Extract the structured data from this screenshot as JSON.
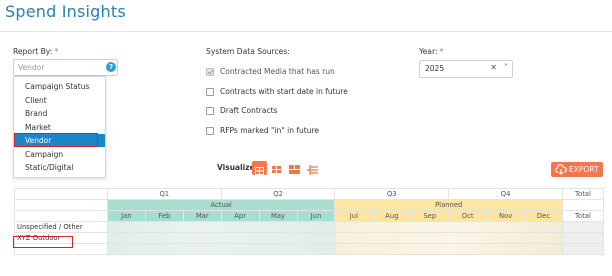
{
  "page": {
    "title": "Spend Insights"
  },
  "report_by": {
    "label": "Report By:",
    "required_mark": "*",
    "placeholder": "Vendor",
    "options": [
      "Campaign Status",
      "Client",
      "Brand",
      "Market",
      "Vendor",
      "Campaign",
      "Static/Digital"
    ],
    "selected": "Vendor"
  },
  "data_sources": {
    "label": "System Data Sources:",
    "items": [
      {
        "label": "Contracted Media that has run",
        "checked": true,
        "disabled": true
      },
      {
        "label": "Contracts with start date in future",
        "checked": false
      },
      {
        "label": "Draft Contracts",
        "checked": false
      },
      {
        "label": "RFPs marked \"in\" in future",
        "checked": false
      }
    ]
  },
  "year": {
    "label": "Year:",
    "required_mark": "*",
    "value": "2025"
  },
  "visualize": {
    "label": "Visualize:",
    "icons": [
      "table-icon",
      "bar-chart-icon",
      "stacked-icon",
      "trend-icon"
    ]
  },
  "export": {
    "label": "EXPORT"
  },
  "grid": {
    "quarters": [
      "Q1",
      "Q2",
      "Q3",
      "Q4"
    ],
    "total_label": "Total",
    "actual_label": "Actual",
    "planned_label": "Planned",
    "months": [
      "Jan",
      "Feb",
      "Mar",
      "Apr",
      "May",
      "Jun",
      "Jul",
      "Aug",
      "Sep",
      "Oct",
      "Nov",
      "Dec"
    ],
    "rows": [
      "Unspecified / Other",
      "XYZ Outdoor"
    ]
  },
  "colors": {
    "accent": "#2a7fb4",
    "actual": "#a8ddd0",
    "planned": "#ffe4a2",
    "export": "#f2784b",
    "selected": "#1e85c6"
  }
}
